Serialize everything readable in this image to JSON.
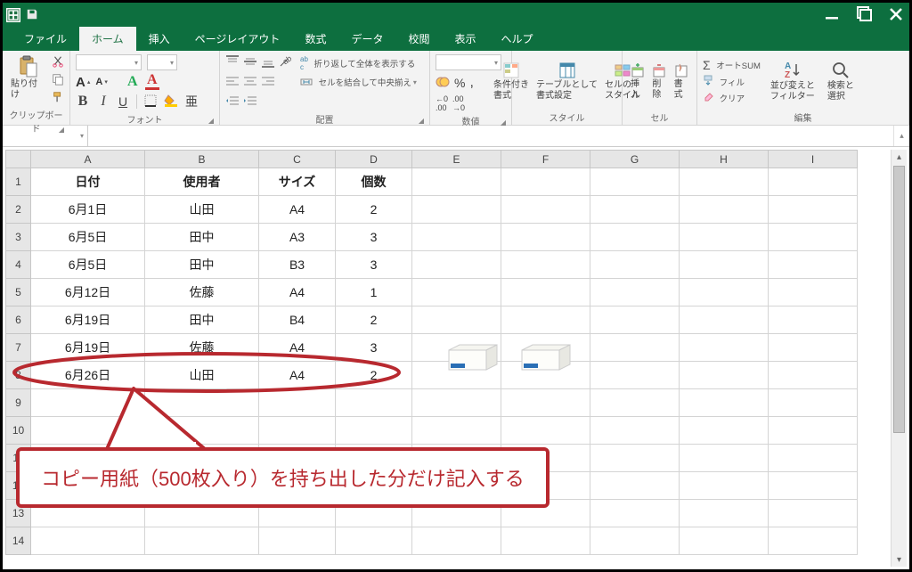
{
  "tabs": {
    "file": "ファイル",
    "home": "ホーム",
    "insert": "挿入",
    "pageLayout": "ページレイアウト",
    "formulas": "数式",
    "data": "データ",
    "review": "校閲",
    "view": "表示",
    "help": "ヘルプ"
  },
  "ribbon": {
    "clipboard": {
      "paste": "貼り付け",
      "label": "クリップボード"
    },
    "font": {
      "label": "フォント"
    },
    "alignment": {
      "wrap": "折り返して全体を表示する",
      "merge": "セルを結合して中央揃え",
      "label": "配置"
    },
    "number": {
      "label": "数値"
    },
    "styles": {
      "cond": "条件付き\n書式",
      "table": "テーブルとして\n書式設定",
      "cell": "セルの\nスタイル",
      "label": "スタイル"
    },
    "cells": {
      "insert": "挿入",
      "delete": "削除",
      "format": "書式",
      "label": "セル"
    },
    "editing": {
      "autosum": "オートSUM",
      "fill": "フィル",
      "clear": "クリア",
      "sort": "並び変えと\nフィルター",
      "find": "検索と\n選択",
      "label": "編集"
    }
  },
  "columns": [
    "A",
    "B",
    "C",
    "D",
    "E",
    "F",
    "G",
    "H",
    "I"
  ],
  "rows": [
    "1",
    "2",
    "3",
    "4",
    "5",
    "6",
    "7",
    "8",
    "9",
    "10",
    "11",
    "12",
    "13",
    "14"
  ],
  "header": {
    "date": "日付",
    "user": "使用者",
    "size": "サイズ",
    "qty": "個数"
  },
  "data": [
    {
      "date": "6月1日",
      "user": "山田",
      "size": "A4",
      "qty": "2"
    },
    {
      "date": "6月5日",
      "user": "田中",
      "size": "A3",
      "qty": "3"
    },
    {
      "date": "6月5日",
      "user": "田中",
      "size": "B3",
      "qty": "3"
    },
    {
      "date": "6月12日",
      "user": "佐藤",
      "size": "A4",
      "qty": "1"
    },
    {
      "date": "6月19日",
      "user": "田中",
      "size": "B4",
      "qty": "2"
    },
    {
      "date": "6月19日",
      "user": "佐藤",
      "size": "A4",
      "qty": "3"
    },
    {
      "date": "6月26日",
      "user": "山田",
      "size": "A4",
      "qty": "2"
    }
  ],
  "callout": "コピー用紙（500枚入り）を持ち出した分だけ記入する"
}
